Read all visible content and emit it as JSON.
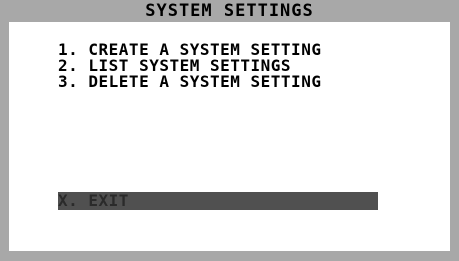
{
  "window": {
    "title": "SYSTEM SETTINGS"
  },
  "menu": {
    "items": [
      {
        "label": "1. CREATE A SYSTEM SETTING"
      },
      {
        "label": "2. LIST SYSTEM SETTINGS"
      },
      {
        "label": "3. DELETE A SYSTEM SETTING"
      }
    ],
    "exit_label": "X. EXIT"
  },
  "colors": {
    "frame": "#a8a8a8",
    "background": "#ffffff",
    "text": "#000000",
    "selection_bar": "#505050"
  }
}
